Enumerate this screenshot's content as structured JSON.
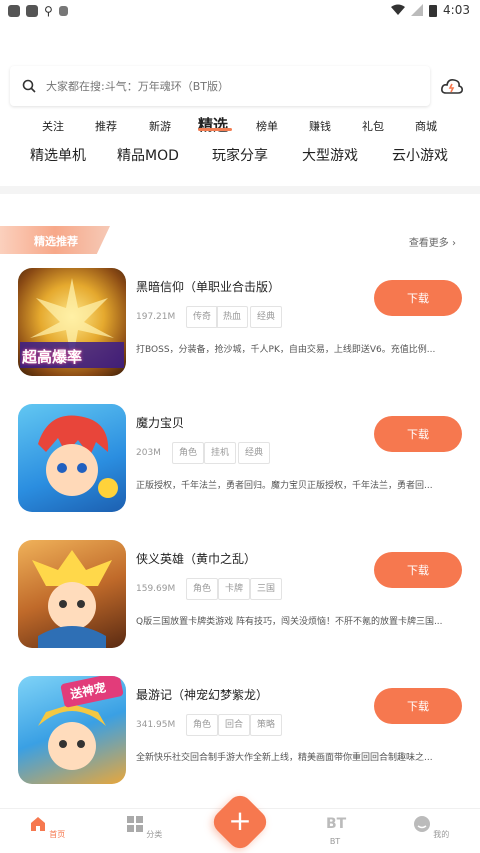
{
  "status": {
    "time": "4:03"
  },
  "search": {
    "placeholder": "大家都在搜:斗气：万年魂环（BT版）"
  },
  "nav_tabs": [
    "关注",
    "推荐",
    "新游",
    "精选",
    "榜单",
    "赚钱",
    "礼包",
    "商城"
  ],
  "nav_active": "精选",
  "categories": [
    "精选单机",
    "精品MOD",
    "玩家分享",
    "大型游戏",
    "云小游戏"
  ],
  "section": {
    "title": "精选推荐",
    "more": "查看更多"
  },
  "download_label": "下载",
  "games": [
    {
      "title": "黑暗信仰（单职业合击版）",
      "size": "197.21M",
      "tags": [
        "传奇",
        "热血",
        "经典"
      ],
      "desc": "打BOSS，分装备，抢沙城，千人PK，自由交易，上线即送V6。充值比例...",
      "icon_text": "超高爆率"
    },
    {
      "title": "魔力宝贝",
      "size": "203M",
      "tags": [
        "角色",
        "挂机",
        "经典"
      ],
      "desc": "正版授权，千年法兰，勇者回归。魔力宝贝正版授权，千年法兰，勇者回...",
      "icon_text": ""
    },
    {
      "title": "侠义英雄（黄巾之乱）",
      "size": "159.69M",
      "tags": [
        "角色",
        "卡牌",
        "三国"
      ],
      "desc": "Q版三国放置卡牌类游戏 阵有技巧，闯关没烦恼！不肝不氪的放置卡牌三国...",
      "icon_text": ""
    },
    {
      "title": "最游记（神宠幻梦紫龙）",
      "size": "341.95M",
      "tags": [
        "角色",
        "回合",
        "策略"
      ],
      "desc": "全新快乐社交回合制手游大作全新上线，精美画面带你重回回合制趣味之...",
      "icon_text": "送神宠"
    }
  ],
  "bottom_tabs": [
    "首页",
    "分类",
    "BT",
    "我的"
  ],
  "colors": {
    "accent": "#f6784f"
  }
}
